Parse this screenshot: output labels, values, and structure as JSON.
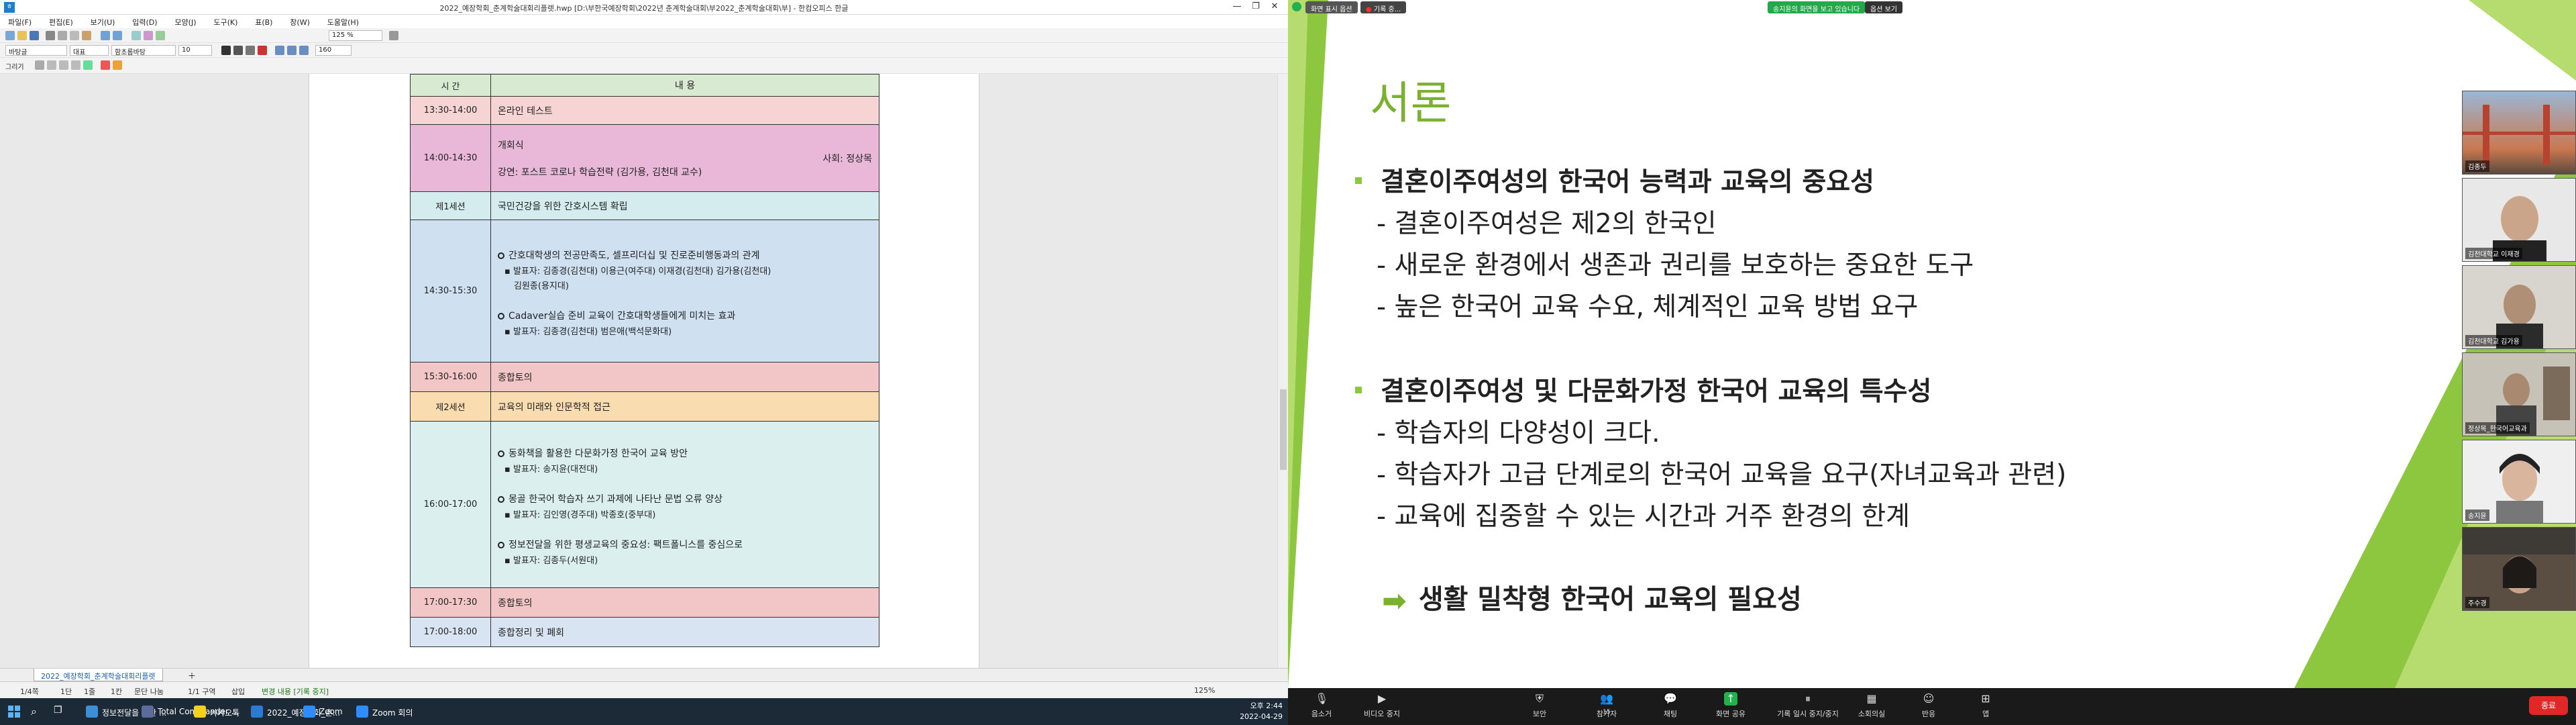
{
  "hwp": {
    "title": "2022_예장학회_춘계학술대회리플렛.hwp [D:\\부한국예장학회\\2022년 춘계학술대회\\부2022_춘계학술대회\\부] - 한컴오피스 한글",
    "menu": [
      "파일(F)",
      "편집(E)",
      "보기(U)",
      "입력(D)",
      "모양(J)",
      "도구(K)",
      "표(B)",
      "창(W)",
      "도움말(H)"
    ],
    "style_dropdown": "바탕글",
    "style2_dropdown": "대표",
    "font_dropdown": "함초롬바탕",
    "size_dropdown": "10",
    "zoom_dropdown": "125 %",
    "ratio_dropdown": "160",
    "draw_label": "그리기",
    "table_header": {
      "time": "시 간",
      "content": "내 용"
    },
    "rows": [
      {
        "time": "13:30-14:00",
        "lines": [
          "온라인 테스트"
        ]
      },
      {
        "time": "14:00-14:30",
        "lines": [
          "개회식"
        ],
        "right": "사회: 정상목",
        "extra": "강연: 포스트 코로나 학습전략 (김가용, 김천대 교수)"
      },
      {
        "time": "제1세션",
        "lines": [
          "국민건강을 위한 간호시스템 확립"
        ]
      },
      {
        "time": "14:30-15:30",
        "items": [
          {
            "title": "간호대학생의 전공만족도, 셀프리더십 및 진로준비행동과의 관계",
            "presenter": "▪ 발표자: 김종경(김천대) 이용근(여주대) 이재경(김천대) 김가용(김천대)",
            "presenter2": "김원종(용지대)"
          },
          {
            "title": "Cadaver실습 준비 교육이 간호대학생들에게 미치는 효과",
            "presenter": "▪ 발표자: 김종경(김천대) 범은애(백석문화대)"
          }
        ]
      },
      {
        "time": "15:30-16:00",
        "lines": [
          "종합토의"
        ]
      },
      {
        "time": "제2세션",
        "lines": [
          "교육의 미래와 인문학적 접근"
        ]
      },
      {
        "time": "16:00-17:00",
        "items": [
          {
            "title": "동화책을 활용한 다문화가정 한국어 교육 방안",
            "presenter": "▪ 발표자: 송지윤(대전대)"
          },
          {
            "title": "몽골 한국어 학습자 쓰기 과제에 나타난 문법 오류 양상",
            "presenter": "▪ 발표자: 김인영(경주대) 박종호(중부대)"
          },
          {
            "title": "정보전달을 위한 평생교육의 중요성: 팩트폴니스를 중심으로",
            "presenter": "▪ 발표자: 김종두(서원대)"
          }
        ]
      },
      {
        "time": "17:00-17:30",
        "lines": [
          "종합토의"
        ]
      },
      {
        "time": "17:00-18:00",
        "lines": [
          "종합정리 및 폐회"
        ]
      }
    ],
    "sheet_tab": "2022_예장학회_춘계학술대회리플렛",
    "status": [
      "1/4쪽",
      "1단",
      "1줄",
      "1칸",
      "문단 나눔",
      "1/1 구역",
      "삽입",
      "변경 내용 [기록 중지]"
    ],
    "status_zoom": "125%"
  },
  "taskbar": {
    "items": [
      {
        "label": "정보전달을 위한 ...",
        "color": "#3c8fd9"
      },
      {
        "label": "Total Commander ...",
        "color": "#5c6b99"
      },
      {
        "label": "카카오톡",
        "color": "#f3d11b"
      },
      {
        "label": "2022_예장학회_춘...",
        "color": "#2c7bd1"
      },
      {
        "label": "Zoom",
        "color": "#2d8cff"
      },
      {
        "label": "Zoom 회의",
        "color": "#2d8cff"
      }
    ],
    "time": "오후 2:44",
    "date": "2022-04-29"
  },
  "zoom": {
    "top_view": "화면 표시 옵션",
    "top_record": "기록 중...",
    "top_share": "송지윤의 화면을 보고 있습니다",
    "top_view_opt": "옵션 보기",
    "slide": {
      "title": "서론",
      "h1": "결혼이주여성의 한국어 능력과 교육의 중요성",
      "s1": [
        "- 결혼이주여성은 제2의 한국인",
        "- 새로운 환경에서 생존과 권리를 보호하는 중요한 도구",
        "- 높은 한국어 교육 수요, 체계적인 교육 방법 요구"
      ],
      "h2": "결혼이주여성 및 다문화가정 한국어 교육의 특수성",
      "s2": [
        "- 학습자의 다양성이 크다.",
        "- 학습자가 고급 단계로의 한국어 교육을 요구(자녀교육과 관련)",
        "- 교육에 집중할 수 있는 시간과 거주 환경의 한계"
      ],
      "conclusion": "생활 밀착형 한국어 교육의 필요성"
    },
    "participants": [
      "김종두",
      "김천대학교 이재경",
      "김천대학교 김가용",
      "정상목_한국어교육과",
      "송지윤",
      "주수경"
    ],
    "controls": [
      "음소거",
      "비디오 중지",
      "보안",
      "참가자",
      "채팅",
      "화면 공유",
      "기록 일시 중지/중지",
      "소회의실",
      "반응",
      "앱"
    ],
    "participant_count": "15",
    "end": "종료"
  }
}
